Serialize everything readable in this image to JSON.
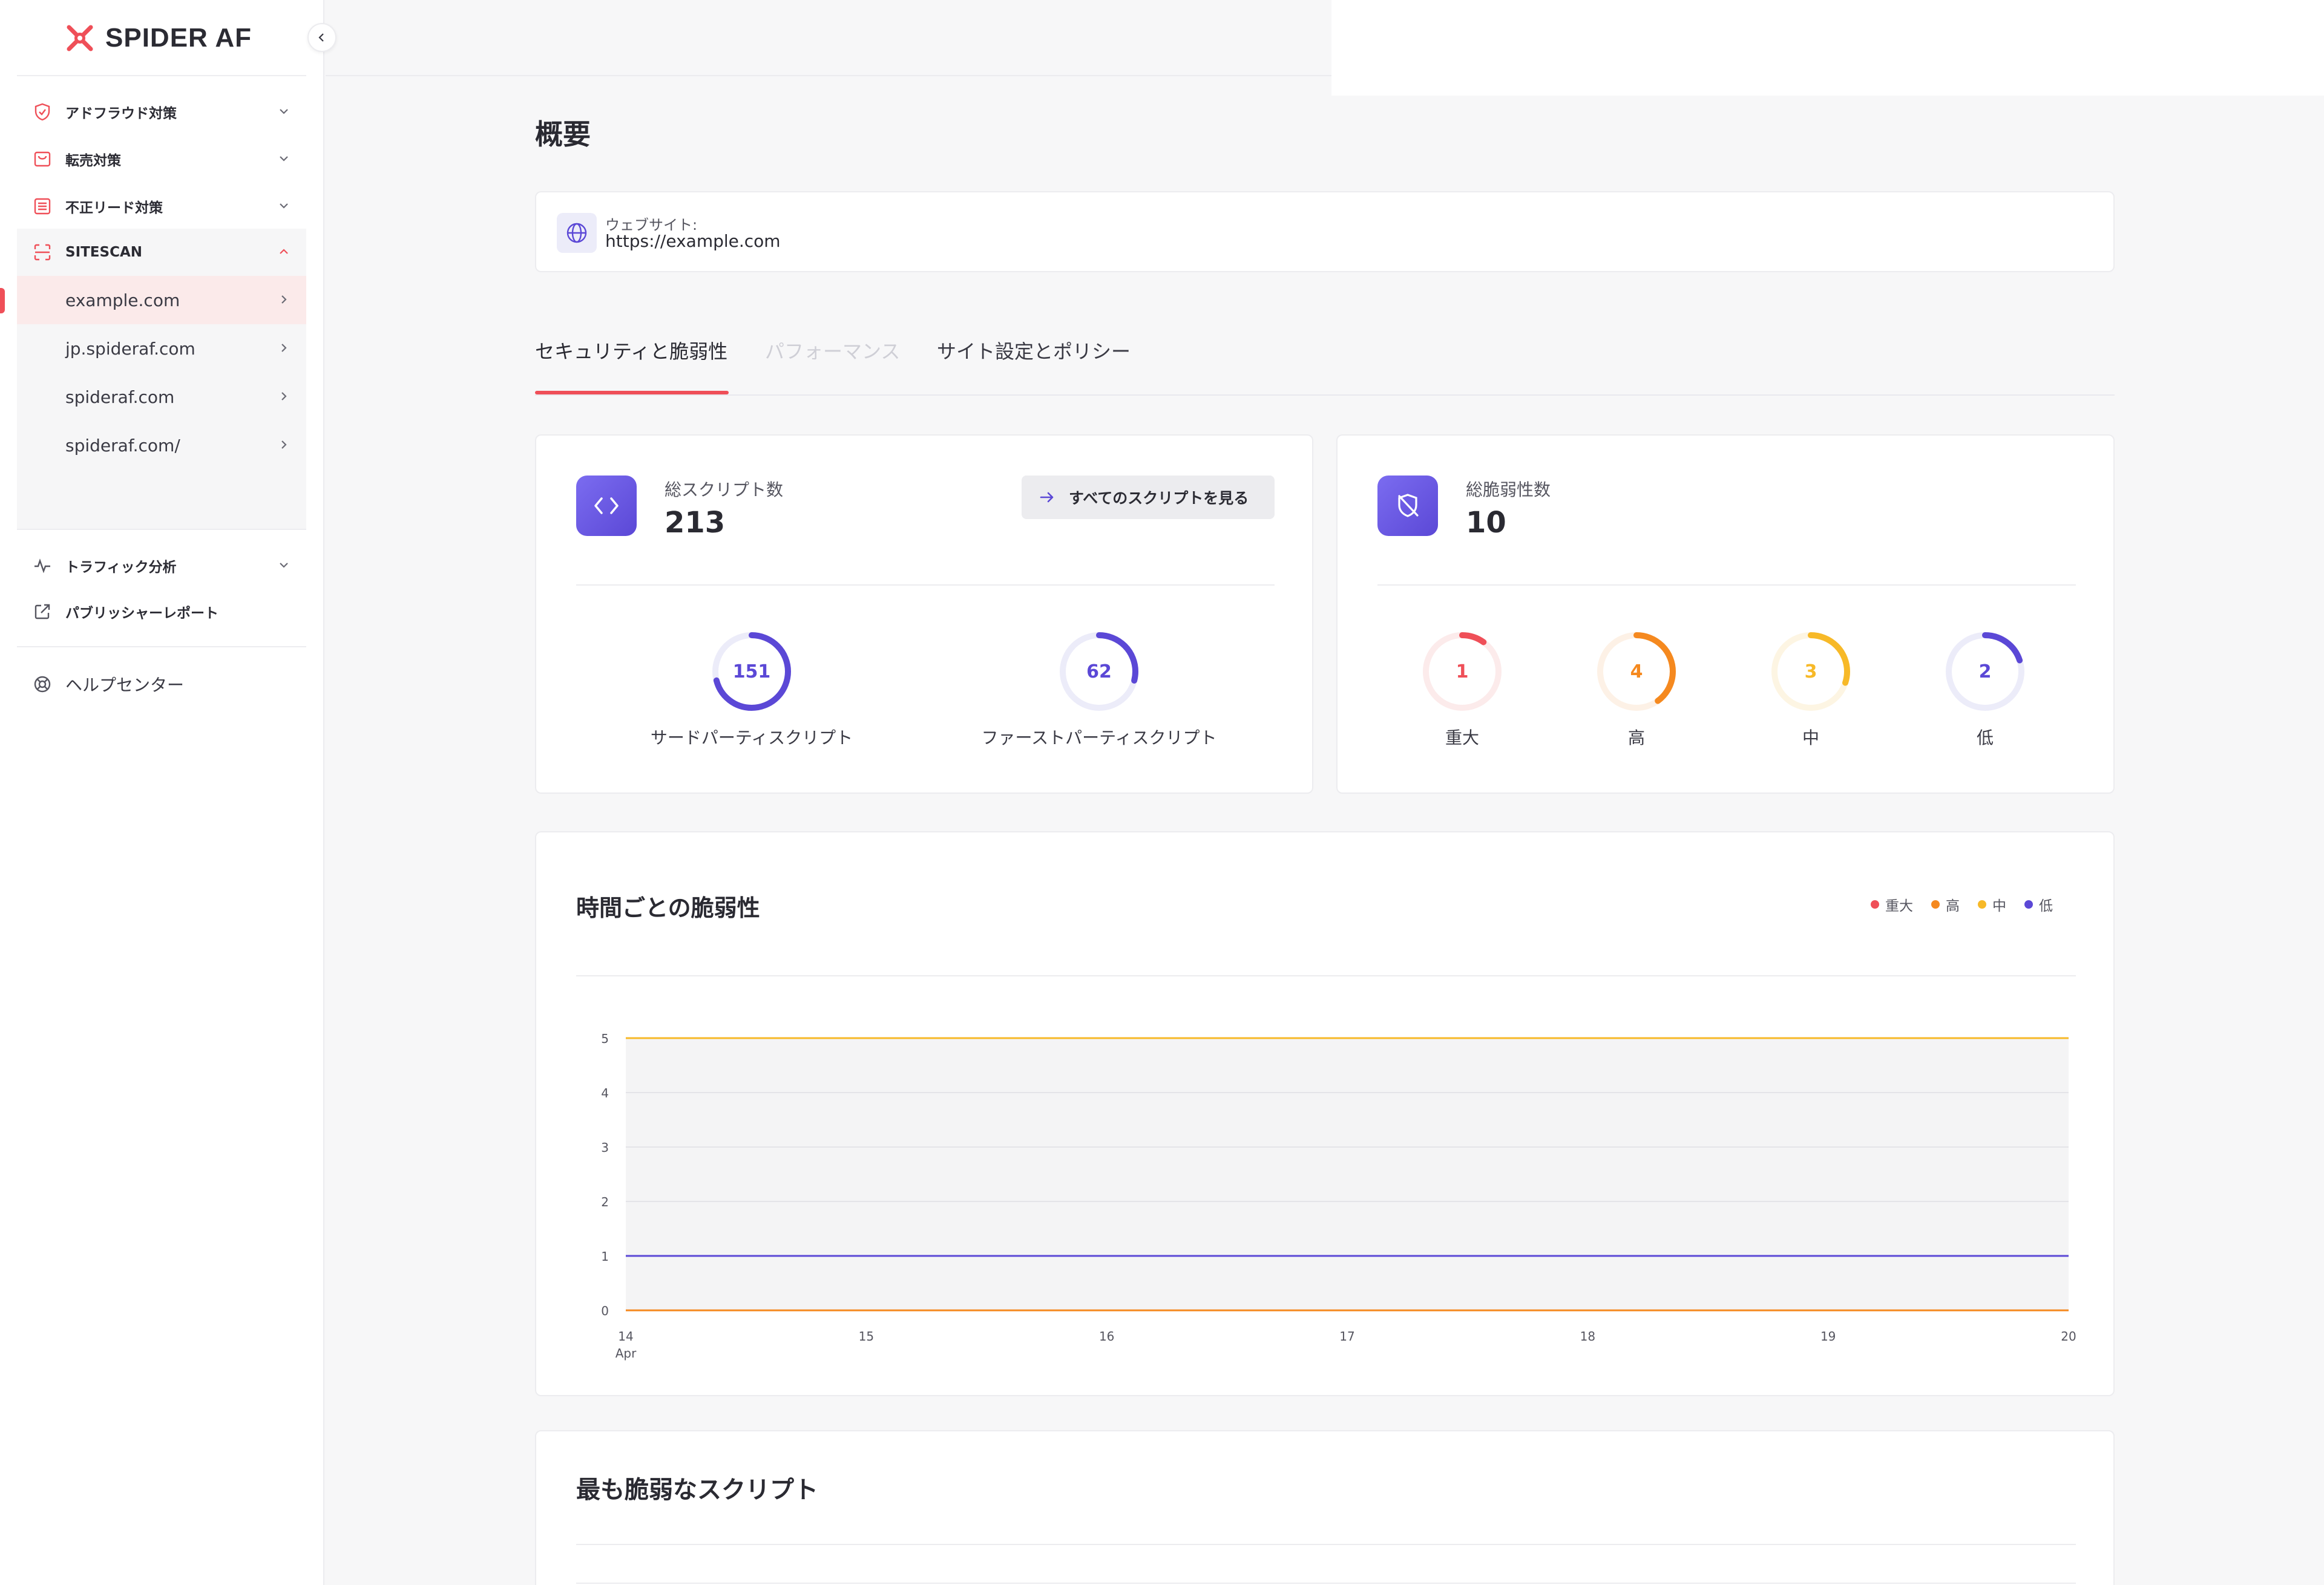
{
  "brand": {
    "name": "SPIDER AF",
    "accent": "#ef4f58",
    "primary": "#5b48d6"
  },
  "sidebar": {
    "sections": [
      {
        "label": "アドフラウド対策",
        "icon": "shield-check-icon"
      },
      {
        "label": "転売対策",
        "icon": "cart-icon"
      },
      {
        "label": "不正リード対策",
        "icon": "form-list-icon"
      },
      {
        "label": "SITESCAN",
        "icon": "scan-icon"
      }
    ],
    "sites": [
      "example.com",
      "jp.spideraf.com",
      "spideraf.com",
      "spideraf.com/"
    ],
    "traffic": "トラフィック分析",
    "publisher": "パブリッシャーレポート",
    "help": "ヘルプセンター"
  },
  "page": {
    "title": "概要",
    "website_label": "ウェブサイト:",
    "website_url": "https://example.com"
  },
  "tabs": [
    {
      "label": "セキュリティと脆弱性",
      "state": "active"
    },
    {
      "label": "パフォーマンス",
      "state": "disabled"
    },
    {
      "label": "サイト設定とポリシー",
      "state": "normal"
    }
  ],
  "scripts": {
    "label": "総スクリプト数",
    "total": "213",
    "view_all": "すべてのスクリプトを見る",
    "third_party": {
      "value": "151",
      "label": "サードパーティスクリプト",
      "fraction": 0.71
    },
    "first_party": {
      "value": "62",
      "label": "ファーストパーティスクリプト",
      "fraction": 0.29
    }
  },
  "vulnerabilities": {
    "label": "総脆弱性数",
    "total": "10",
    "levels": [
      {
        "value": "1",
        "label": "重大",
        "color": "#ef4f58",
        "fraction": 0.1
      },
      {
        "value": "4",
        "label": "高",
        "color": "#f5891f",
        "fraction": 0.4
      },
      {
        "value": "3",
        "label": "中",
        "color": "#f7b928",
        "fraction": 0.3
      },
      {
        "value": "2",
        "label": "低",
        "color": "#5b48d6",
        "fraction": 0.2
      }
    ]
  },
  "chart_data": {
    "type": "line",
    "title": "時間ごとの脆弱性",
    "x": [
      "14",
      "15",
      "16",
      "17",
      "18",
      "19",
      "20"
    ],
    "x_sublabel": "Apr",
    "yticks": [
      "0",
      "1",
      "2",
      "3",
      "4",
      "5"
    ],
    "ylim": [
      0,
      5
    ],
    "legend_position": "top-right",
    "series": [
      {
        "name": "重大",
        "color": "#ef4f58",
        "values": [
          0,
          0,
          0,
          0,
          0,
          0,
          0
        ]
      },
      {
        "name": "高",
        "color": "#f5891f",
        "values": [
          0,
          0,
          0,
          0,
          0,
          0,
          0
        ]
      },
      {
        "name": "中",
        "color": "#f7b928",
        "values": [
          5,
          5,
          5,
          5,
          5,
          5,
          5
        ]
      },
      {
        "name": "低",
        "color": "#5b48d6",
        "values": [
          1,
          1,
          1,
          1,
          1,
          1,
          1
        ]
      }
    ]
  },
  "most_vulnerable": {
    "title": "最も脆弱なスクリプト"
  }
}
